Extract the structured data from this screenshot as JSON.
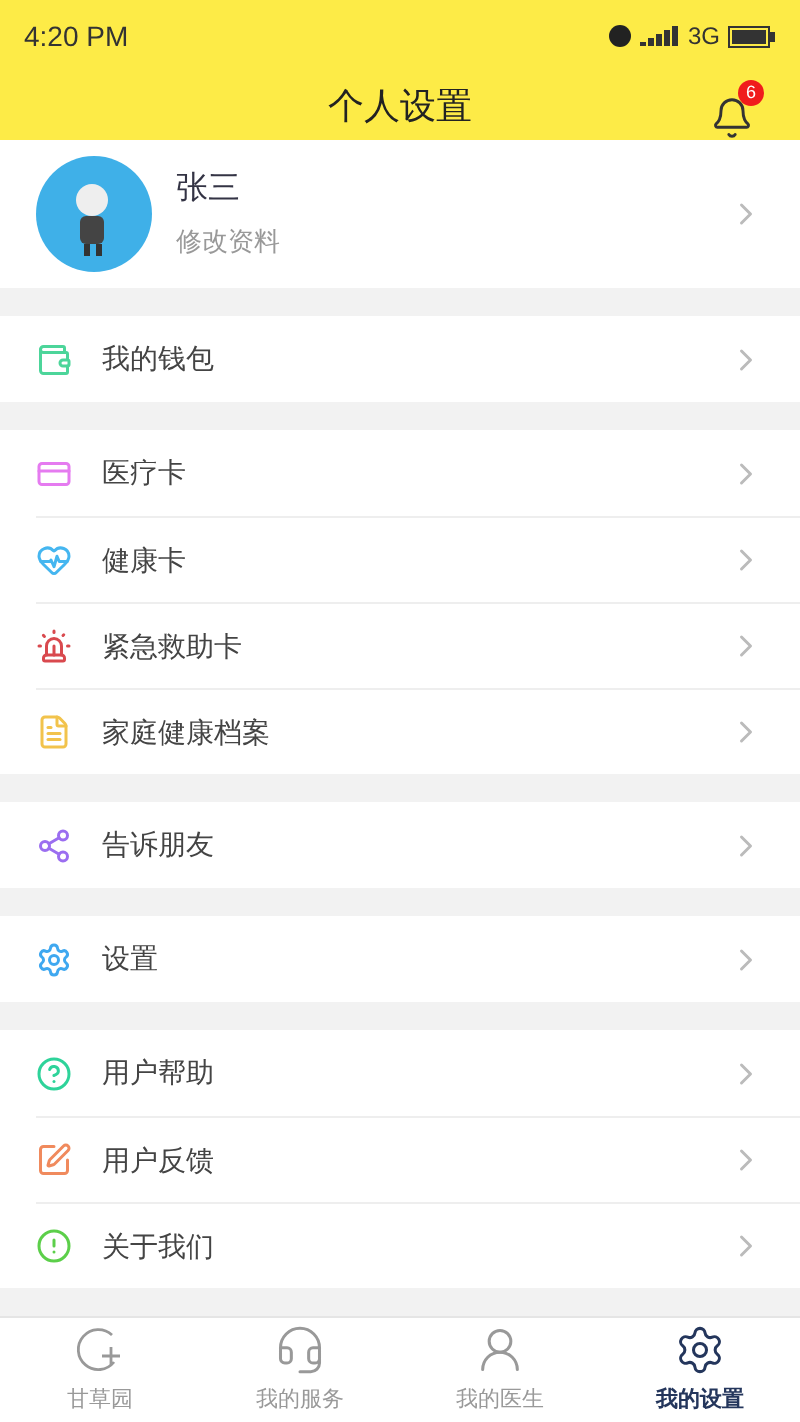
{
  "status_bar": {
    "time": "4:20 PM",
    "network": "3G"
  },
  "header": {
    "title": "个人设置",
    "notification_count": "6"
  },
  "profile": {
    "name": "张三",
    "subtitle": "修改资料"
  },
  "groups": [
    {
      "items": [
        {
          "label": "我的钱包"
        }
      ]
    },
    {
      "items": [
        {
          "label": "医疗卡"
        },
        {
          "label": "健康卡"
        },
        {
          "label": "紧急救助卡"
        },
        {
          "label": "家庭健康档案"
        }
      ]
    },
    {
      "items": [
        {
          "label": "告诉朋友"
        }
      ]
    },
    {
      "items": [
        {
          "label": "设置"
        }
      ]
    },
    {
      "items": [
        {
          "label": "用户帮助"
        },
        {
          "label": "用户反馈"
        },
        {
          "label": "关于我们"
        }
      ]
    }
  ],
  "tabs": [
    {
      "label": "甘草园",
      "selected": false
    },
    {
      "label": "我的服务",
      "selected": false
    },
    {
      "label": "我的医生",
      "selected": false
    },
    {
      "label": "我的设置",
      "selected": true
    }
  ]
}
